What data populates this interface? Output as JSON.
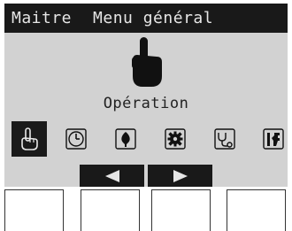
{
  "header": {
    "mode": "Maitre",
    "title": "Menu général"
  },
  "selected_label": "Opération",
  "icons": [
    {
      "name": "operation-hand-icon",
      "selected": true
    },
    {
      "name": "clock-icon",
      "selected": false
    },
    {
      "name": "energy-saving-icon",
      "selected": false
    },
    {
      "name": "gear-icon",
      "selected": false
    },
    {
      "name": "maintenance-icon",
      "selected": false
    },
    {
      "name": "service-tools-icon",
      "selected": false
    }
  ],
  "navigation": {
    "left": "triangle-left-icon",
    "right": "triangle-right-icon"
  },
  "colors": {
    "screen_bg": "#d2d2d2",
    "bar_dark": "#191919",
    "header_text": "#e6e6e6"
  }
}
